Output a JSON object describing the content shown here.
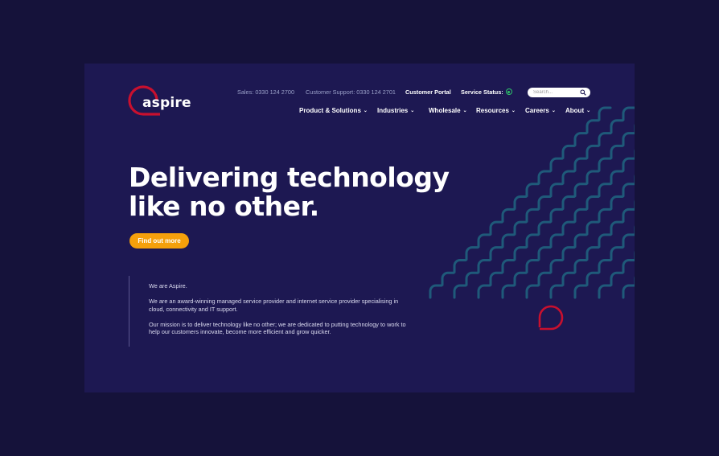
{
  "brand": {
    "name": "aspire",
    "colors": {
      "background": "#1d1852",
      "page_background": "#15123a",
      "accent_red": "#c8102e",
      "cta_orange": "#f5a00b",
      "pattern_teal": "#1f5a7a",
      "status_green": "#2ec46b"
    }
  },
  "topbar": {
    "sales_label": "Sales:",
    "sales_phone": "0330 124 2700",
    "support_label": "Customer Support:",
    "support_phone": "0330 124 2701",
    "portal_label": "Customer Portal",
    "status_label": "Service Status:",
    "status_icon": "status-ok-icon"
  },
  "search": {
    "placeholder": "Search...",
    "icon": "search-icon"
  },
  "nav": {
    "items": [
      {
        "label": "Product & Solutions"
      },
      {
        "label": "Industries"
      },
      {
        "label": "Wholesale"
      },
      {
        "label": "Resources"
      },
      {
        "label": "Careers"
      },
      {
        "label": "About"
      }
    ]
  },
  "hero": {
    "title_line1": "Delivering technology",
    "title_line2": "like no other.",
    "cta_label": "Find out more"
  },
  "intro": {
    "p1": "We are Aspire.",
    "p2": "We are an award-winning managed service provider and internet service provider specialising in cloud, connectivity and IT support.",
    "p3": "Our mission is to deliver technology like no other; we are dedicated to putting technology to work to help our customers innovate, become more efficient and grow quicker."
  }
}
